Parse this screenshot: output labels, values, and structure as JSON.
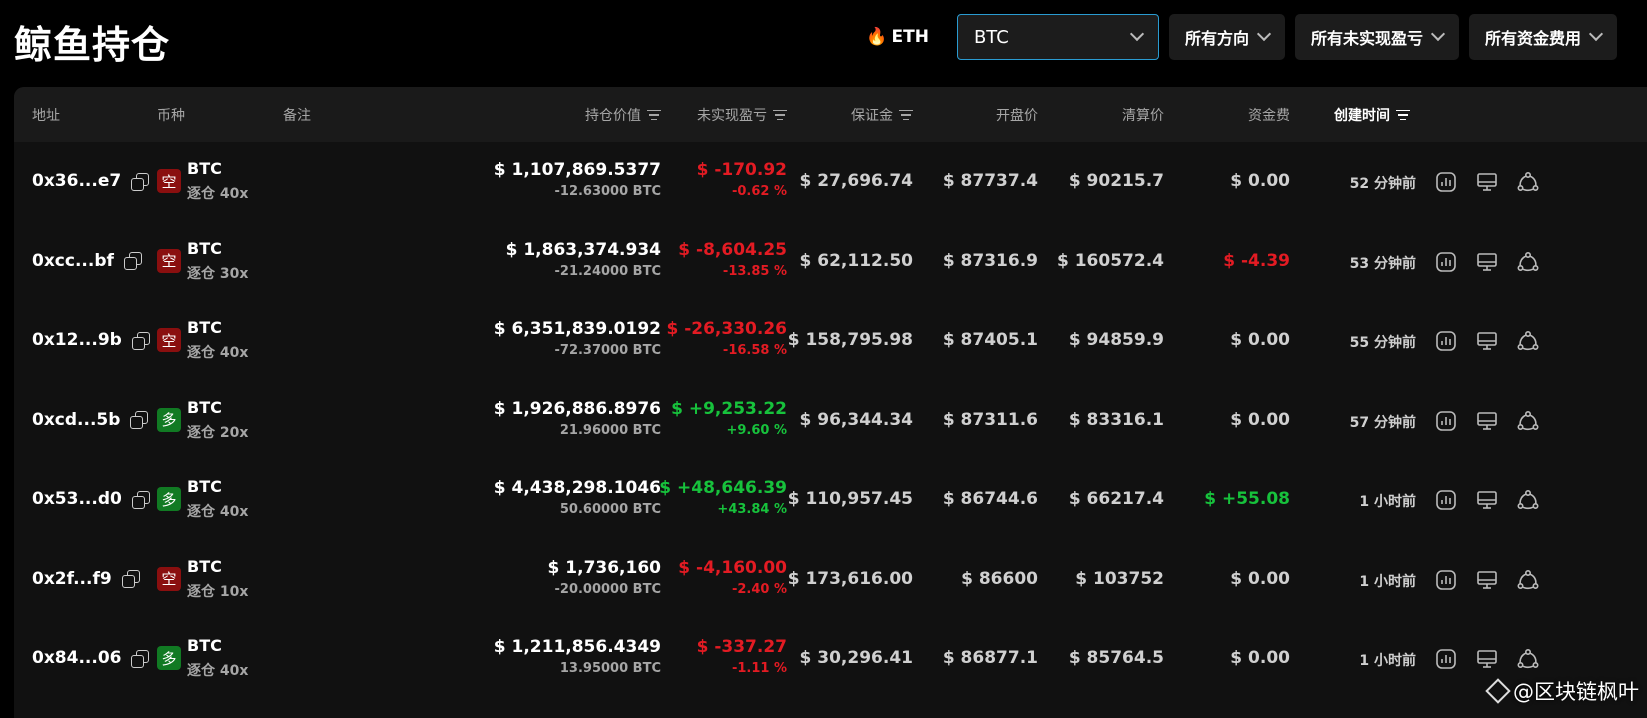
{
  "page": {
    "title": "鲸鱼持仓"
  },
  "controls": {
    "eth_label": "ETH",
    "coin_select_value": "BTC",
    "filter_direction": "所有方向",
    "filter_pnl": "所有未实现盈亏",
    "filter_funding": "所有资金费用"
  },
  "table": {
    "headers": {
      "address": "地址",
      "coin": "币种",
      "note": "备注",
      "position_value": "持仓价值",
      "unrealized_pnl": "未实现盈亏",
      "margin": "保证金",
      "entry_price": "开盘价",
      "liq_price": "清算价",
      "funding": "资金费",
      "created": "创建时间"
    },
    "rows": [
      {
        "address": "0x36...e7",
        "direction": "空",
        "dir": "short",
        "coin": "BTC",
        "leverage": "逐仓 40x",
        "value": "$ 1,107,869.5377",
        "size": "-12.63000 BTC",
        "pnl": "$ -170.92",
        "pnl_pct": "-0.62 %",
        "pnl_sign": "neg",
        "margin": "$ 27,696.74",
        "entry": "$ 87737.4",
        "liq": "$ 90215.7",
        "funding": "$ 0.00",
        "funding_sign": "zero",
        "time": "52 分钟前"
      },
      {
        "address": "0xcc...bf",
        "direction": "空",
        "dir": "short",
        "coin": "BTC",
        "leverage": "逐仓 30x",
        "value": "$ 1,863,374.934",
        "size": "-21.24000 BTC",
        "pnl": "$ -8,604.25",
        "pnl_pct": "-13.85 %",
        "pnl_sign": "neg",
        "margin": "$ 62,112.50",
        "entry": "$ 87316.9",
        "liq": "$ 160572.4",
        "funding": "$ -4.39",
        "funding_sign": "neg",
        "time": "53 分钟前"
      },
      {
        "address": "0x12...9b",
        "direction": "空",
        "dir": "short",
        "coin": "BTC",
        "leverage": "逐仓 40x",
        "value": "$ 6,351,839.0192",
        "size": "-72.37000 BTC",
        "pnl": "$ -26,330.26",
        "pnl_pct": "-16.58 %",
        "pnl_sign": "neg",
        "margin": "$ 158,795.98",
        "entry": "$ 87405.1",
        "liq": "$ 94859.9",
        "funding": "$ 0.00",
        "funding_sign": "zero",
        "time": "55 分钟前"
      },
      {
        "address": "0xcd...5b",
        "direction": "多",
        "dir": "long",
        "coin": "BTC",
        "leverage": "逐仓 20x",
        "value": "$ 1,926,886.8976",
        "size": "21.96000 BTC",
        "pnl": "$ +9,253.22",
        "pnl_pct": "+9.60 %",
        "pnl_sign": "pos",
        "margin": "$ 96,344.34",
        "entry": "$ 87311.6",
        "liq": "$ 83316.1",
        "funding": "$ 0.00",
        "funding_sign": "zero",
        "time": "57 分钟前"
      },
      {
        "address": "0x53...d0",
        "direction": "多",
        "dir": "long",
        "coin": "BTC",
        "leverage": "逐仓 40x",
        "value": "$ 4,438,298.1046",
        "size": "50.60000 BTC",
        "pnl": "$ +48,646.39",
        "pnl_pct": "+43.84 %",
        "pnl_sign": "pos",
        "margin": "$ 110,957.45",
        "entry": "$ 86744.6",
        "liq": "$ 66217.4",
        "funding": "$ +55.08",
        "funding_sign": "pos",
        "time": "1 小时前"
      },
      {
        "address": "0x2f...f9",
        "direction": "空",
        "dir": "short",
        "coin": "BTC",
        "leverage": "逐仓 10x",
        "value": "$ 1,736,160",
        "size": "-20.00000 BTC",
        "pnl": "$ -4,160.00",
        "pnl_pct": "-2.40 %",
        "pnl_sign": "neg",
        "margin": "$ 173,616.00",
        "entry": "$ 86600",
        "liq": "$ 103752",
        "funding": "$ 0.00",
        "funding_sign": "zero",
        "time": "1 小时前"
      },
      {
        "address": "0x84...06",
        "direction": "多",
        "dir": "long",
        "coin": "BTC",
        "leverage": "逐仓 40x",
        "value": "$ 1,211,856.4349",
        "size": "13.95000 BTC",
        "pnl": "$ -337.27",
        "pnl_pct": "-1.11 %",
        "pnl_sign": "neg",
        "margin": "$ 30,296.41",
        "entry": "$ 86877.1",
        "liq": "$ 85764.5",
        "funding": "$ 0.00",
        "funding_sign": "zero",
        "time": "1 小时前"
      }
    ]
  },
  "watermark": "@区块链枫叶",
  "colors": {
    "up": "#17c23c",
    "down": "#e31b23",
    "short_badge": "#8a0f0f",
    "long_badge": "#117a23",
    "select_border": "#2a9bd1"
  },
  "icons": {
    "row_actions": [
      "chart-icon",
      "monitor-icon",
      "share-nodes-icon"
    ],
    "copy": "copy-icon",
    "eth": "flame-icon"
  }
}
